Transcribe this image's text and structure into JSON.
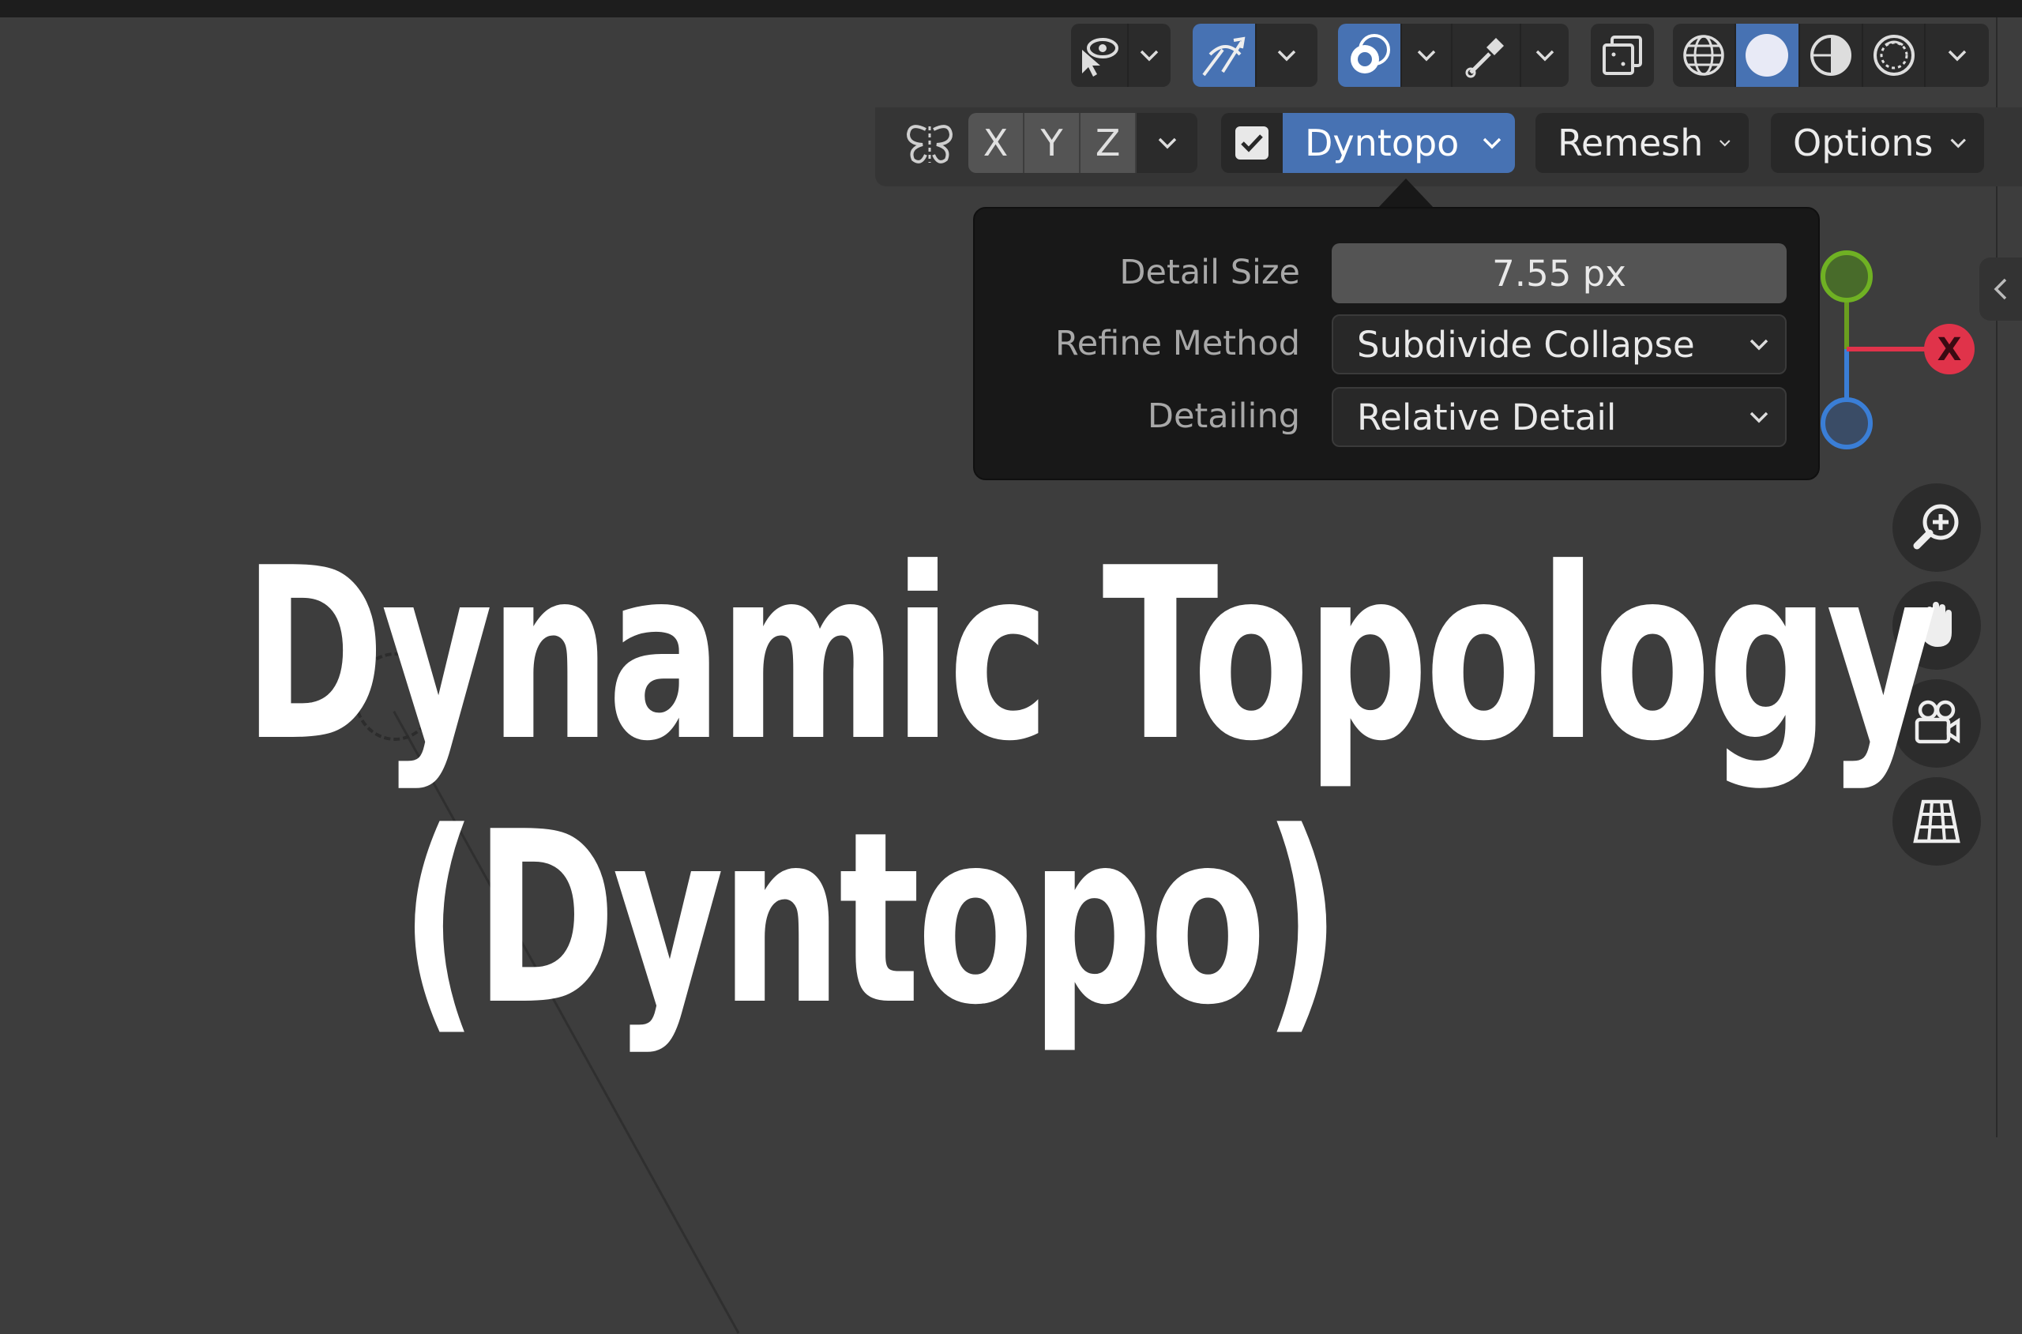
{
  "toolbar": {
    "header_buttons": [
      {
        "name": "visibility-toggle",
        "icon": "eye-cursor-icon"
      },
      {
        "name": "gizmo-toggle",
        "icon": "gizmo-arrows-icon",
        "active": true
      },
      {
        "name": "overlays-toggle",
        "icon": "overlay-circles-icon",
        "active": true
      },
      {
        "name": "eyedropper-tool",
        "icon": "eyedropper-icon"
      },
      {
        "name": "xray-toggle",
        "icon": "xray-icon"
      }
    ],
    "shading_modes": [
      {
        "name": "wireframe",
        "icon": "wireframe-sphere-icon"
      },
      {
        "name": "solid",
        "icon": "solid-sphere-icon",
        "active": true
      },
      {
        "name": "material-preview",
        "icon": "material-sphere-icon"
      },
      {
        "name": "rendered",
        "icon": "rendered-sphere-icon"
      }
    ]
  },
  "symmetry": {
    "icon": "butterfly-mirror-icon",
    "axes": [
      "X",
      "Y",
      "Z"
    ]
  },
  "dyntopo": {
    "enabled": true,
    "label": "Dyntopo"
  },
  "remesh": {
    "label": "Remesh"
  },
  "options": {
    "label": "Options"
  },
  "popup": {
    "detail_size_label": "Detail Size",
    "detail_size_value": "7.55 px",
    "refine_method_label": "Refine Method",
    "refine_method_value": "Subdivide Collapse",
    "detailing_label": "Detailing",
    "detailing_value": "Relative Detail"
  },
  "gizmo": {
    "x_label": "X",
    "colors": {
      "x": "#e0334a",
      "y": "#6a9e1f",
      "z": "#3a7ed6"
    }
  },
  "nav_buttons": [
    "zoom-in-icon",
    "hand-pan-icon",
    "camera-icon",
    "perspective-grid-icon"
  ],
  "overlay": {
    "line1": "Dynamic Topology",
    "line2": "(Dyntopo)"
  },
  "colors": {
    "accent": "#4772b3",
    "viewport_bg": "#3d3d3d",
    "popup_bg": "#181818"
  }
}
